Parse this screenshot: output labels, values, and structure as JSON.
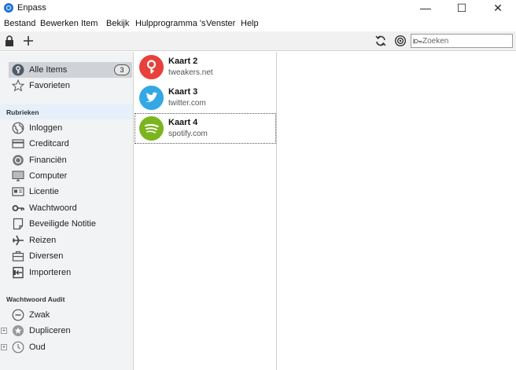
{
  "window": {
    "title": "Enpass",
    "minimize": "—",
    "maximize": "☐",
    "close": "✕"
  },
  "menu": [
    "Bestand",
    "Bewerken",
    "Item",
    "Bekijk",
    "Hulpprogramma 's",
    "Venster",
    "Help"
  ],
  "toolbar": {
    "search_placeholder": "Zoeken"
  },
  "sidebar": {
    "all_items": {
      "label": "Alle Items",
      "count": "3"
    },
    "favorites": {
      "label": "Favorieten"
    },
    "categories_header": "Rubrieken",
    "categories": [
      {
        "label": "Inloggen",
        "icon": "globe-icon"
      },
      {
        "label": "Creditcard",
        "icon": "creditcard-icon"
      },
      {
        "label": "Financiën",
        "icon": "finance-icon"
      },
      {
        "label": "Computer",
        "icon": "computer-icon"
      },
      {
        "label": "Licentie",
        "icon": "license-icon"
      },
      {
        "label": "Wachtwoord",
        "icon": "key-icon"
      },
      {
        "label": "Beveiligde Notitie",
        "icon": "note-icon"
      },
      {
        "label": "Reizen",
        "icon": "plane-icon"
      },
      {
        "label": "Diversen",
        "icon": "briefcase-icon"
      },
      {
        "label": "Importeren",
        "icon": "import-icon"
      }
    ],
    "audit_header": "Wachtwoord Audit",
    "audit": [
      {
        "label": "Zwak",
        "icon": "minus-circle-icon"
      },
      {
        "label": "Dupliceren",
        "icon": "duplicate-icon"
      },
      {
        "label": "Oud",
        "icon": "clock-icon"
      }
    ]
  },
  "items": [
    {
      "title": "Kaart 2",
      "subtitle": "tweakers.net",
      "color": "#e8403a",
      "icon": "tweakers-icon"
    },
    {
      "title": "Kaart 3",
      "subtitle": "twitter.com",
      "color": "#33a8e4",
      "icon": "twitter-icon"
    },
    {
      "title": "Kaart 4",
      "subtitle": "spotify.com",
      "color": "#7ab51d",
      "icon": "spotify-icon"
    }
  ]
}
